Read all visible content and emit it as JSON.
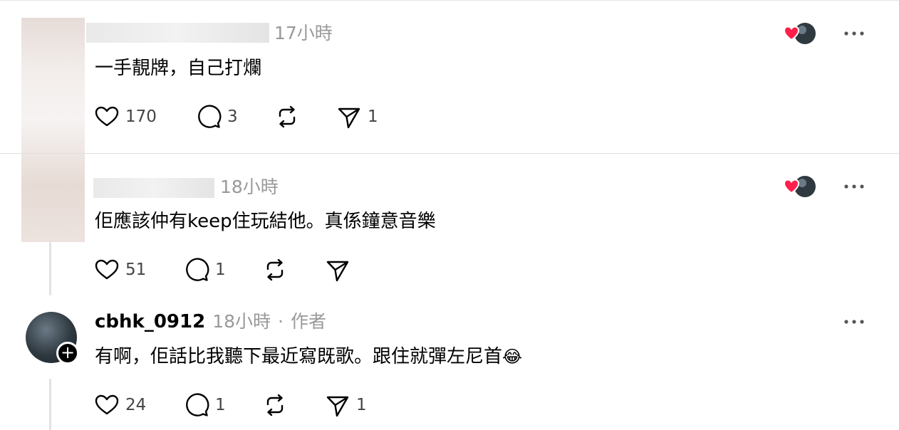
{
  "comments": [
    {
      "time": "17小時",
      "text": "一手靚牌，自己打爛",
      "likes": "170",
      "replies": "3",
      "shares": "1"
    },
    {
      "time": "18小時",
      "text": "佢應該仲有keep住玩結他。真係鐘意音樂",
      "likes": "51",
      "replies": "1"
    },
    {
      "username": "cbhk_0912",
      "time": "18小時",
      "separator": "·",
      "author_tag": "作者",
      "text": "有啊，佢話比我聽下最近寫既歌。跟住就彈左尼首",
      "emoji": "😂",
      "likes": "24",
      "replies": "1",
      "shares": "1"
    }
  ],
  "icons": [
    "heart-icon",
    "comment-icon",
    "repost-icon",
    "share-icon",
    "more-icon",
    "liked-by-author-icon",
    "follow-plus-icon"
  ],
  "colors": {
    "like_heart": "#ff1f4b",
    "meta_gray": "#999999"
  }
}
